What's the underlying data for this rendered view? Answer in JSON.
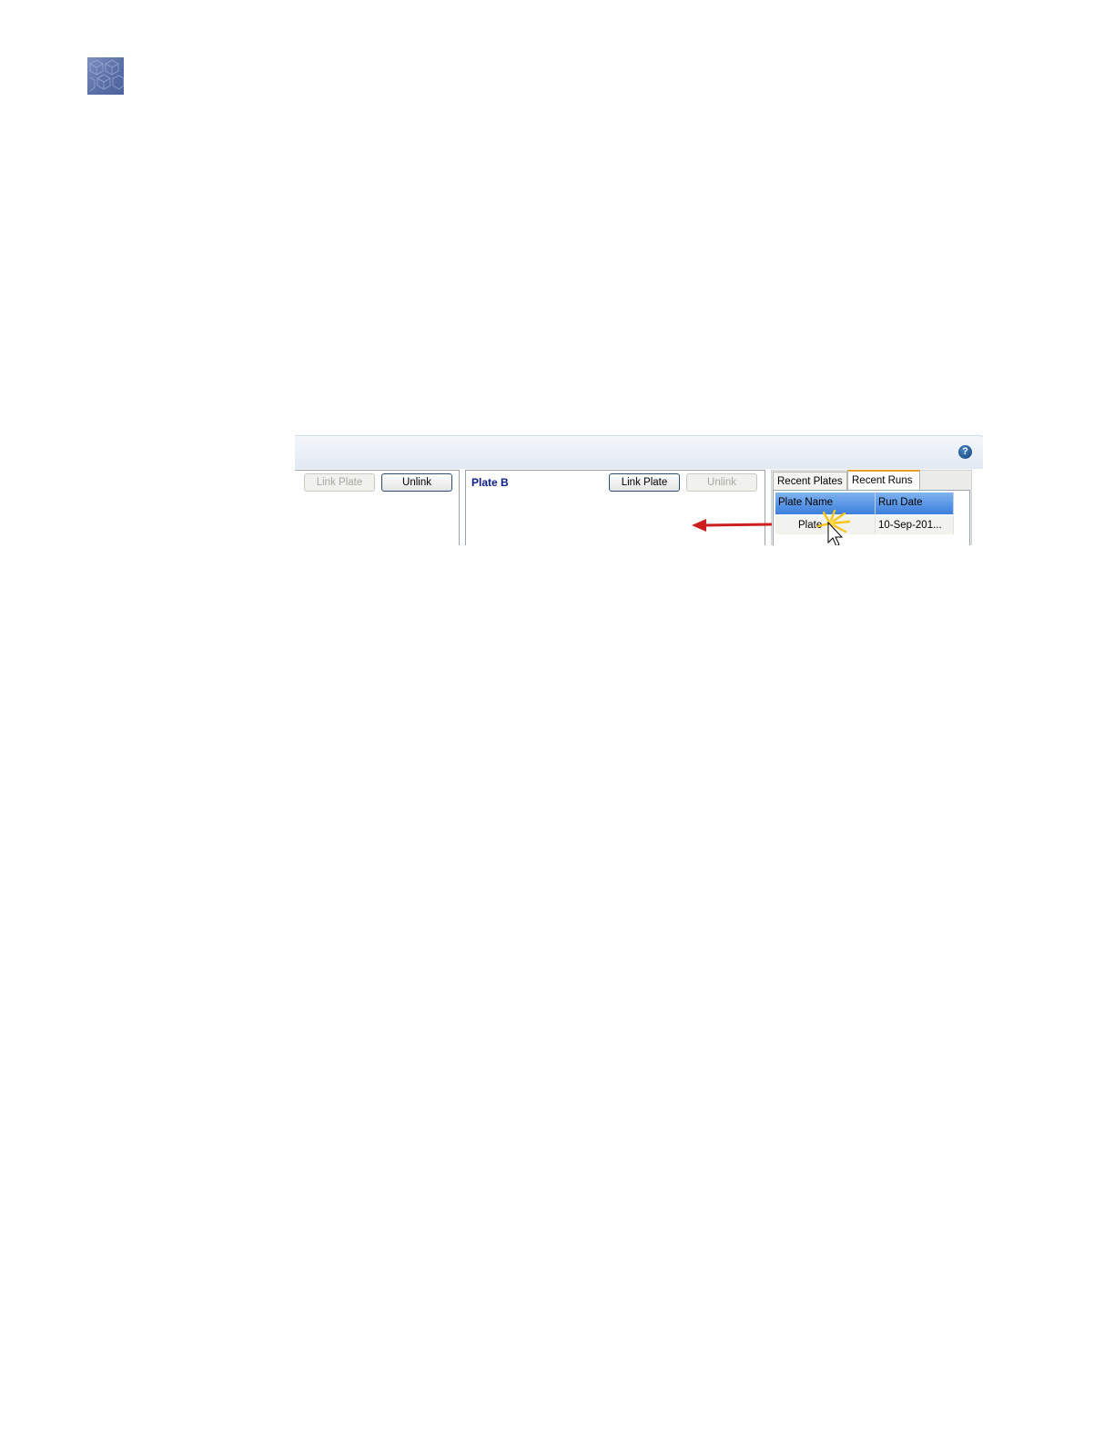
{
  "left_panel": {
    "link_plate_label": "Link Plate",
    "unlink_label": "Unlink"
  },
  "plate_b": {
    "title": "Plate B",
    "link_plate_label": "Link Plate",
    "unlink_label": "Unlink"
  },
  "tabs": [
    {
      "label": "Recent Plates",
      "active": false
    },
    {
      "label": "Recent Runs",
      "active": true
    }
  ],
  "table": {
    "columns": [
      "Plate Name",
      "Run Date"
    ],
    "rows": [
      [
        "Plate",
        "10-Sep-201..."
      ]
    ]
  },
  "help_glyph": "?",
  "icons": [
    "logo-cube-icon",
    "help-icon",
    "red-arrow-icon",
    "cursor-icon",
    "click-burst-icon"
  ],
  "colors": {
    "plate_title": "#0c1c8c",
    "header_blue": "#3d7fdc",
    "arrow_red": "#cc1f1f",
    "active_tab_accent": "#e79f2a",
    "burst_yellow": "#f5c518"
  }
}
